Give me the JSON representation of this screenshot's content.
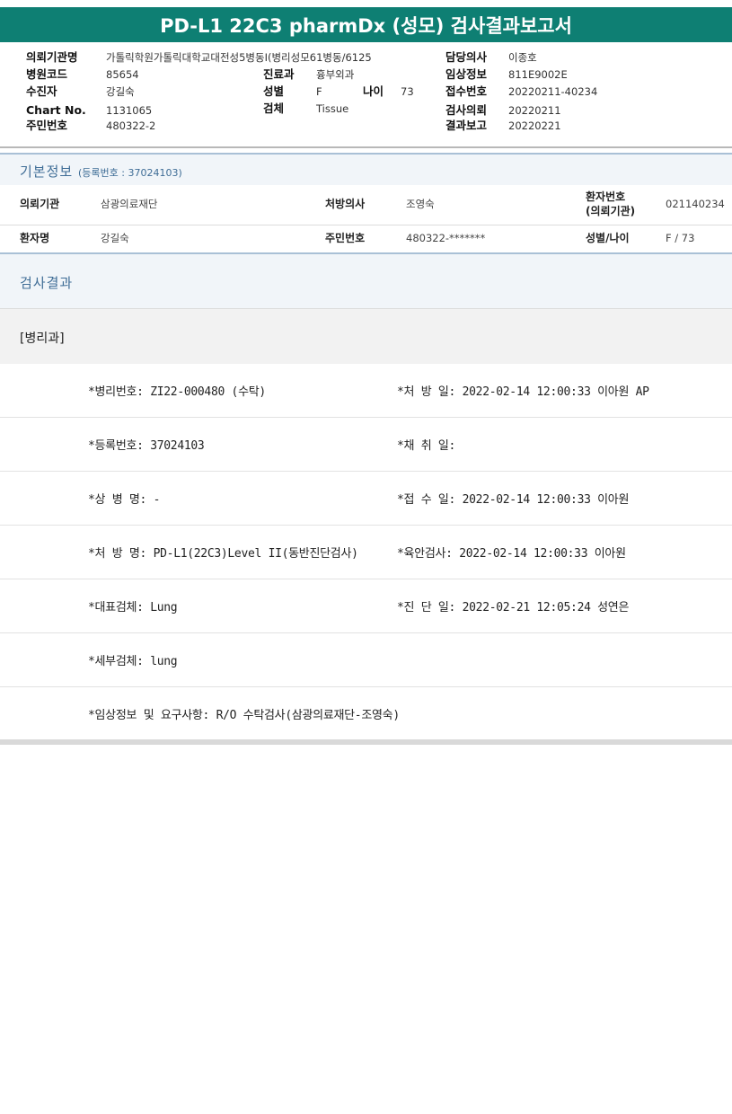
{
  "title": "PD-L1 22C3 pharmDx (성모) 검사결과보고서",
  "header": {
    "col1": [
      {
        "k": "의뢰기관명",
        "v": "가톨릭학원가톨릭대학교대전성5병동I(병리성모61병동/6125"
      },
      {
        "k": "병원코드",
        "v": "85654"
      },
      {
        "k": "수진자",
        "v": "강길숙"
      },
      {
        "k": "Chart No.",
        "v": "1131065"
      },
      {
        "k": "주민번호",
        "v": "480322-2"
      }
    ],
    "col2": [
      {
        "k": "진료과",
        "v": "흉부외과"
      },
      {
        "k": "성별",
        "v": "F"
      },
      {
        "k": "검체",
        "v": "Tissue"
      }
    ],
    "age": {
      "k": "나이",
      "v": "73"
    },
    "col3": [
      {
        "k": "담당의사",
        "v": "이종호"
      },
      {
        "k": "임상정보",
        "v": "811E9002E"
      },
      {
        "k": "접수번호",
        "v": "20220211-40234"
      },
      {
        "k": "검사의뢰",
        "v": "20220211"
      },
      {
        "k": "결과보고",
        "v": "20220221"
      }
    ]
  },
  "basic": {
    "title": "기본정보",
    "sub": "(등록번호 : 37024103)",
    "row1": {
      "k1": "의뢰기관",
      "v1": "삼광의료재단",
      "k2": "처방의사",
      "v2": "조영숙",
      "k3a": "환자번호",
      "k3b": "(의뢰기관)",
      "v3": "021140234"
    },
    "row2": {
      "k1": "환자명",
      "v1": "강길숙",
      "k2": "주민번호",
      "v2": "480322-*******",
      "k3": "성별/나이",
      "v3": "F / 73"
    }
  },
  "result": {
    "title": "검사결과",
    "dept": "[병리과]",
    "rows": [
      {
        "left": "*병리번호: ZI22-000480 (수탁)",
        "right": "*처 방 일: 2022-02-14 12:00:33  이아원 AP"
      },
      {
        "left": "*등록번호: 37024103",
        "right": "*채 취 일:"
      },
      {
        "left": "*상 병 명: -",
        "right": "*접 수 일: 2022-02-14 12:00:33  이아원"
      },
      {
        "left": "*처 방 명: PD-L1(22C3)Level II(동반진단검사)",
        "right": "*육안검사: 2022-02-14 12:00:33  이아원"
      },
      {
        "left": "*대표검체: Lung",
        "right": "*진 단 일: 2022-02-21 12:05:24  성연은"
      },
      {
        "left": "*세부검체: lung",
        "right": ""
      },
      {
        "left": "*임상정보 및 요구사항: R/O 수탁검사(삼광의료재단-조영숙)",
        "right": ""
      }
    ]
  }
}
